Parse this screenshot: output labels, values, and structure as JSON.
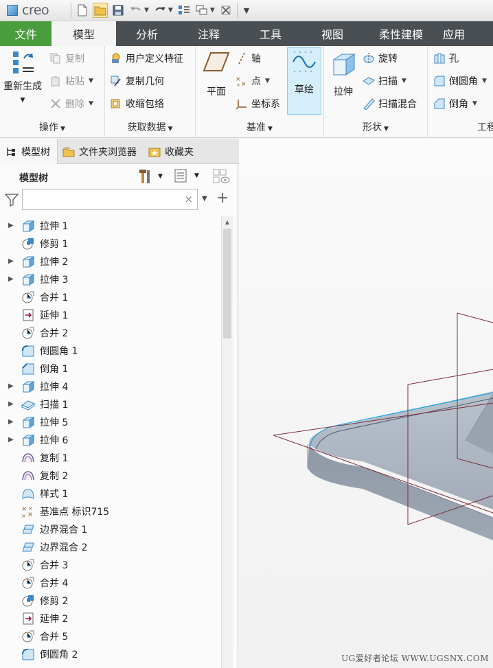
{
  "app": {
    "logo_text": "creo"
  },
  "ribbon_tabs": [
    "文件",
    "模型",
    "分析",
    "注释",
    "工具",
    "视图",
    "柔性建模",
    "应用"
  ],
  "ribbon": {
    "ops": {
      "regen": "重新生成",
      "copy": "复制",
      "paste": "粘贴",
      "delete": "删除",
      "label": "操作"
    },
    "getdata": {
      "udf": "用户定义特征",
      "copygeom": "复制几何",
      "shrinkwrap": "收缩包络",
      "label": "获取数据"
    },
    "datum": {
      "plane": "平面",
      "axis": "轴",
      "point": "点",
      "csys": "坐标系",
      "sketch": "草绘",
      "label": "基准"
    },
    "shapes": {
      "extrude": "拉伸",
      "revolve": "旋转",
      "sweep": "扫描",
      "swept_blend": "扫描混合",
      "label": "形状"
    },
    "eng": {
      "hole": "孔",
      "round": "倒圆角",
      "chamfer": "倒角",
      "label": "工程"
    }
  },
  "navigator": {
    "tabs": [
      "模型树",
      "文件夹浏览器",
      "收藏夹"
    ],
    "title": "模型树",
    "search": {
      "value": "",
      "placeholder": ""
    },
    "items": [
      {
        "label": "拉伸 1",
        "icon": "extrude-icon",
        "expandable": true
      },
      {
        "label": "修剪 1",
        "icon": "trim-icon",
        "expandable": false
      },
      {
        "label": "拉伸 2",
        "icon": "extrude-icon",
        "expandable": true
      },
      {
        "label": "拉伸 3",
        "icon": "extrude-icon",
        "expandable": true
      },
      {
        "label": "合并 1",
        "icon": "merge-icon",
        "expandable": false
      },
      {
        "label": "延伸 1",
        "icon": "extend-icon",
        "expandable": false
      },
      {
        "label": "合并 2",
        "icon": "merge-icon",
        "expandable": false
      },
      {
        "label": "倒圆角 1",
        "icon": "round-icon",
        "expandable": false
      },
      {
        "label": "倒角 1",
        "icon": "chamfer-icon",
        "expandable": false
      },
      {
        "label": "拉伸 4",
        "icon": "extrude-icon",
        "expandable": true
      },
      {
        "label": "扫描 1",
        "icon": "sweep-icon",
        "expandable": true
      },
      {
        "label": "拉伸 5",
        "icon": "extrude-icon",
        "expandable": true
      },
      {
        "label": "拉伸 6",
        "icon": "extrude-icon",
        "expandable": true
      },
      {
        "label": "复制 1",
        "icon": "copy-surface-icon",
        "expandable": false
      },
      {
        "label": "复制 2",
        "icon": "copy-surface-icon",
        "expandable": false
      },
      {
        "label": "样式 1",
        "icon": "style-icon",
        "expandable": false
      },
      {
        "label": "基准点 标识715",
        "icon": "datum-point-icon",
        "expandable": false
      },
      {
        "label": "边界混合 1",
        "icon": "boundary-blend-icon",
        "expandable": false
      },
      {
        "label": "边界混合 2",
        "icon": "boundary-blend-icon",
        "expandable": false
      },
      {
        "label": "合并 3",
        "icon": "merge-icon",
        "expandable": false
      },
      {
        "label": "合并 4",
        "icon": "merge-icon",
        "expandable": false
      },
      {
        "label": "修剪 2",
        "icon": "trim-icon",
        "expandable": false
      },
      {
        "label": "延伸 2",
        "icon": "extend-icon",
        "expandable": false
      },
      {
        "label": "合并 5",
        "icon": "merge-icon",
        "expandable": false
      },
      {
        "label": "倒圆角 2",
        "icon": "round-icon",
        "expandable": false
      }
    ]
  },
  "watermark": "UG爱好者论坛 WWW.UGSNX.COM",
  "colors": {
    "file_tab": "#4a9d3c",
    "tab_bar": "#4a4f53",
    "selected_tool": "#d4eefc",
    "model_body": "#9aa3b0",
    "highlight_curve": "#2aa8e0",
    "datum_plane": "#7a2b3a"
  }
}
